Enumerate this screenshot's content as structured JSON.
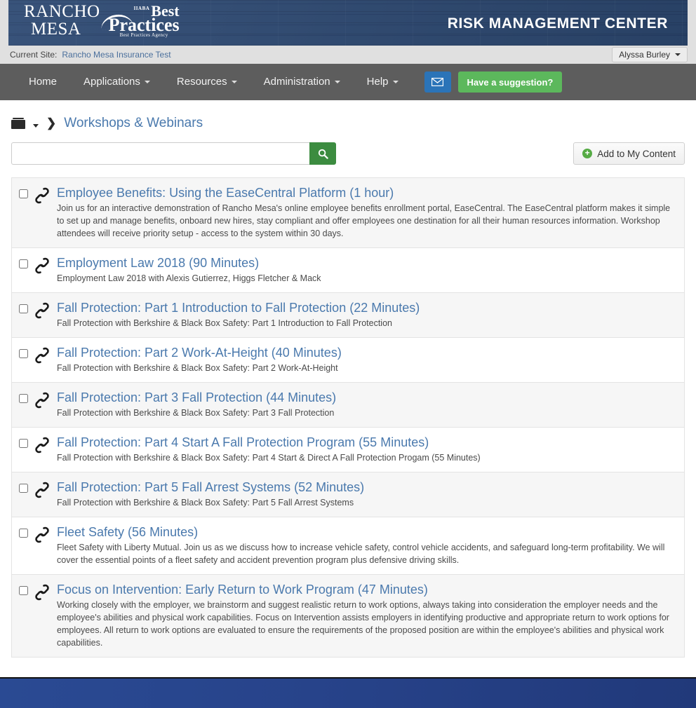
{
  "header": {
    "brand": {
      "line1": "RANCHO",
      "line2": "MESA",
      "bp_iiaba": "IIABA",
      "bp_best": "Best",
      "bp_practices": "Practices",
      "bp_tagline": "Best Practices Agency"
    },
    "title": "RISK MANAGEMENT CENTER"
  },
  "sitebar": {
    "label": "Current Site:",
    "site": "Rancho Mesa Insurance Test",
    "user": "Alyssa Burley"
  },
  "nav": {
    "items": [
      {
        "label": "Home",
        "has_caret": false
      },
      {
        "label": "Applications",
        "has_caret": true
      },
      {
        "label": "Resources",
        "has_caret": true
      },
      {
        "label": "Administration",
        "has_caret": true
      },
      {
        "label": "Help",
        "has_caret": true
      }
    ],
    "mail_icon": "envelope-icon",
    "suggestion_label": "Have a suggestion?",
    "colors": {
      "mail_button": "#2b74b8",
      "suggestion_button": "#5cb85c",
      "navbar": "#5d5d5d"
    }
  },
  "breadcrumb": {
    "folder_icon": "folder-icon",
    "separator": "❯",
    "current": "Workshops & Webinars"
  },
  "toolbar": {
    "search_value": "",
    "search_placeholder": "",
    "search_icon": "search-icon",
    "add_label": "Add to My Content",
    "add_icon": "plus-circle-icon"
  },
  "items": [
    {
      "title": "Employee Benefits: Using the EaseCentral Platform (1 hour)",
      "desc": "Join us for an interactive demonstration of Rancho Mesa's online employee benefits enrollment portal, EaseCentral. The EaseCentral platform makes it simple to set up and manage benefits, onboard new hires, stay compliant and offer employees one destination for all their human resources information. Workshop attendees will receive priority setup - access to the system within 30 days."
    },
    {
      "title": "Employment Law 2018 (90 Minutes)",
      "desc": "Employment Law 2018 with Alexis Gutierrez, Higgs Fletcher & Mack"
    },
    {
      "title": "Fall Protection: Part 1 Introduction to Fall Protection (22 Minutes)",
      "desc": "Fall Protection with Berkshire & Black Box Safety: Part 1 Introduction to Fall Protection"
    },
    {
      "title": "Fall Protection: Part 2 Work-At-Height (40 Minutes)",
      "desc": "Fall Protection with Berkshire & Black Box Safety: Part 2 Work-At-Height"
    },
    {
      "title": "Fall Protection: Part 3 Fall Protection (44 Minutes)",
      "desc": "Fall Protection with Berkshire & Black Box Safety: Part 3 Fall Protection"
    },
    {
      "title": "Fall Protection: Part 4 Start A Fall Protection Program (55 Minutes)",
      "desc": "Fall Protection with Berkshire & Black Box Safety: Part 4 Start & Direct A Fall Protection Progam (55 Minutes)"
    },
    {
      "title": "Fall Protection: Part 5 Fall Arrest Systems (52 Minutes)",
      "desc": "Fall Protection with Berkshire & Black Box Safety: Part 5 Fall Arrest Systems"
    },
    {
      "title": "Fleet Safety (56 Minutes)",
      "desc": "Fleet Safety with Liberty Mutual. Join us as we discuss how to increase vehicle safety, control vehicle accidents, and safeguard long-term profitability. We will cover the essential points of a fleet safety and accident prevention program plus defensive driving skills."
    },
    {
      "title": "Focus on Intervention: Early Return to Work Program (47 Minutes)",
      "desc": "Working closely with the employer, we brainstorm and suggest realistic return to work options, always taking into consideration the employer needs and the employee's abilities and physical work capabilities. Focus on Intervention assists employers in identifying productive and appropriate return to work options for employees. All return to work options are evaluated to ensure the requirements of the proposed position are within the employee's abilities and physical work capabilities."
    }
  ]
}
